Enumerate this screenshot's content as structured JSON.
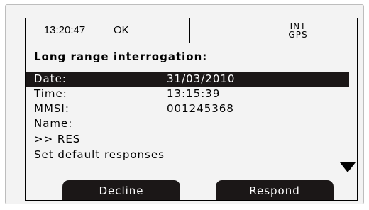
{
  "status_bar": {
    "time": "13:20:47",
    "status": "OK",
    "source_line1": "INT",
    "source_line2": "GPS"
  },
  "screen": {
    "title": "Long range interrogation:",
    "rows": [
      {
        "label": "Date:",
        "value": "31/03/2010",
        "selected": true
      },
      {
        "label": "Time:",
        "value": "13:15:39"
      },
      {
        "label": "MMSI:",
        "value": "001245368"
      },
      {
        "label": "Name:",
        "value": ""
      },
      {
        "label": ">> RES",
        "value": ""
      },
      {
        "label": "Set default responses",
        "value": ""
      }
    ]
  },
  "icons": {
    "scroll_indicator": "triangle-down-icon"
  },
  "softkeys": {
    "left": "Decline",
    "right": "Respond"
  },
  "colors": {
    "screen_background": "#f3f3f3",
    "highlight": "#1b1717",
    "highlight_text": "#ffffff"
  }
}
